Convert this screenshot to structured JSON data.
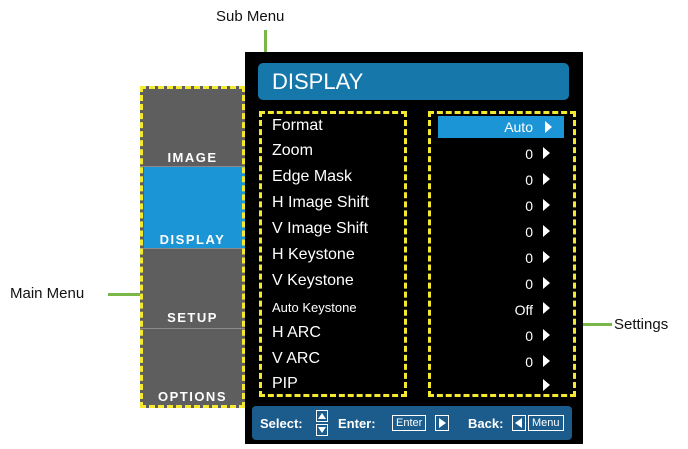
{
  "callouts": {
    "sub_menu": "Sub Menu",
    "main_menu": "Main Menu",
    "settings": "Settings"
  },
  "main_menu": {
    "items": [
      "IMAGE",
      "DISPLAY",
      "SETUP",
      "OPTIONS"
    ],
    "active": "DISPLAY"
  },
  "osd": {
    "title": "DISPLAY",
    "sub_menu": [
      {
        "label": "Format",
        "value": "Auto"
      },
      {
        "label": "Zoom",
        "value": "0"
      },
      {
        "label": "Edge Mask",
        "value": "0"
      },
      {
        "label": "H Image Shift",
        "value": "0"
      },
      {
        "label": "V Image Shift",
        "value": "0"
      },
      {
        "label": "H Keystone",
        "value": "0"
      },
      {
        "label": "V Keystone",
        "value": "0"
      },
      {
        "label": "Auto Keystone",
        "value": "Off"
      },
      {
        "label": "H ARC",
        "value": "0"
      },
      {
        "label": "V ARC",
        "value": "0"
      },
      {
        "label": "PIP",
        "value": ""
      }
    ]
  },
  "footer": {
    "select_label": "Select:",
    "enter_label": "Enter:",
    "enter_key": "Enter",
    "back_label": "Back:",
    "menu_key": "Menu"
  },
  "colors": {
    "accent_blue": "#1b95d6",
    "dash_yellow": "#f4e830",
    "callout_green": "#7ab648"
  }
}
